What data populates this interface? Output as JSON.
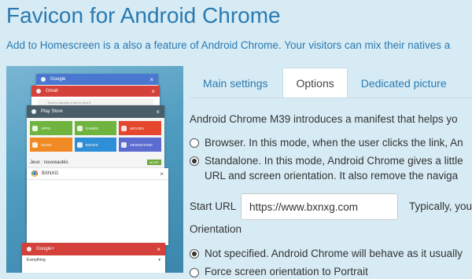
{
  "page": {
    "title": "Favicon for Android Chrome",
    "subtitle": "Add to Homescreen is a also a feature of Android Chrome. Your visitors can mix their natives a"
  },
  "phone": {
    "cards": {
      "google": "Google",
      "gmail": "Gmail",
      "gmail_row": "Touch a sample email to view it",
      "playstore": "Play Store",
      "tiles": [
        {
          "label": "APPS",
          "color": "#6fb43f"
        },
        {
          "label": "GAMES",
          "color": "#6fb43f"
        },
        {
          "label": "MOVIES",
          "color": "#e4472e"
        },
        {
          "label": "MUSIC",
          "color": "#f08a24"
        },
        {
          "label": "BOOKS",
          "color": "#2f8fd6"
        },
        {
          "label": "NEWSSTAND",
          "color": "#5c6bd0"
        }
      ],
      "jeux": "Jeux : nouveautés",
      "jeux_more": "MORE",
      "bxnxg": "BXNXG",
      "googleplus": "Google+",
      "everything": "Everything"
    }
  },
  "tabs": [
    {
      "label": "Main settings",
      "active": false
    },
    {
      "label": "Options",
      "active": true
    },
    {
      "label": "Dedicated picture",
      "active": false
    }
  ],
  "content": {
    "intro": "Android Chrome M39 introduces a manifest that helps yo",
    "browser_option": "Browser. In this mode, when the user clicks the link, An",
    "standalone_line1": "Standalone. In this mode, Android Chrome gives a little",
    "standalone_line2": "URL and screen orientation. It also remove the naviga",
    "start_url_label": "Start URL",
    "start_url_value": "https://www.bxnxg.com",
    "start_url_hint": "Typically, you",
    "orientation_label": "Orientation",
    "not_specified": "Not specified. Android Chrome will behave as it usually",
    "force_portrait": "Force screen orientation to Portrait"
  }
}
